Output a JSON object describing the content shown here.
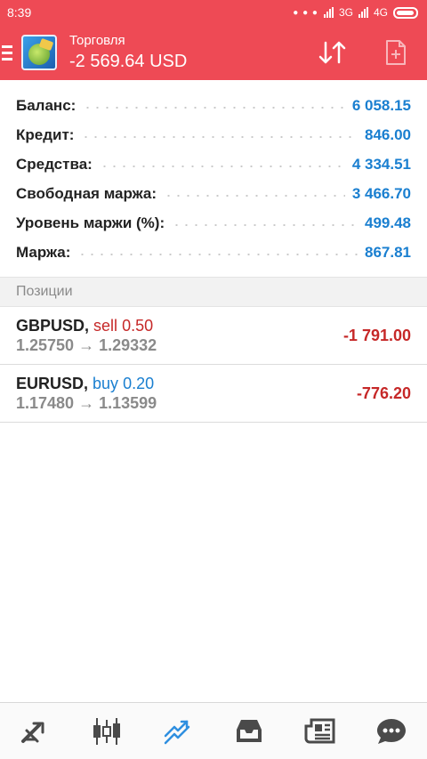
{
  "status_bar": {
    "time": "8:39",
    "network_1": "3G",
    "network_2": "4G"
  },
  "app_bar": {
    "title": "Торговля",
    "subtitle": "-2 569.64 USD",
    "colors": {
      "background": "#ee4a55",
      "text": "#ffffff"
    }
  },
  "summary": [
    {
      "label": "Баланс:",
      "value": "6 058.15"
    },
    {
      "label": "Кредит:",
      "value": "846.00"
    },
    {
      "label": "Средства:",
      "value": "4 334.51"
    },
    {
      "label": "Свободная маржа:",
      "value": "3 466.70"
    },
    {
      "label": "Уровень маржи (%):",
      "value": "499.48"
    },
    {
      "label": "Маржа:",
      "value": "867.81"
    }
  ],
  "positions_header": "Позиции",
  "positions": [
    {
      "symbol": "GBPUSD,",
      "direction": "sell",
      "volume": "0.50",
      "prices": "1.25750 → 1.29332",
      "profit": "-1 791.00"
    },
    {
      "symbol": "EURUSD,",
      "direction": "buy",
      "volume": "0.20",
      "prices": "1.17480 → 1.13599",
      "profit": "-776.20"
    }
  ],
  "bottom_nav": [
    {
      "icon": "quotes-icon",
      "active": false
    },
    {
      "icon": "chart-icon",
      "active": false
    },
    {
      "icon": "trade-icon",
      "active": true
    },
    {
      "icon": "history-icon",
      "active": false
    },
    {
      "icon": "news-icon",
      "active": false
    },
    {
      "icon": "chat-icon",
      "active": false
    }
  ],
  "colors": {
    "value_blue": "#1a7fd0",
    "loss_red": "#c62828",
    "nav_active": "#2f8fe0",
    "nav_inactive": "#4a4a4a"
  }
}
